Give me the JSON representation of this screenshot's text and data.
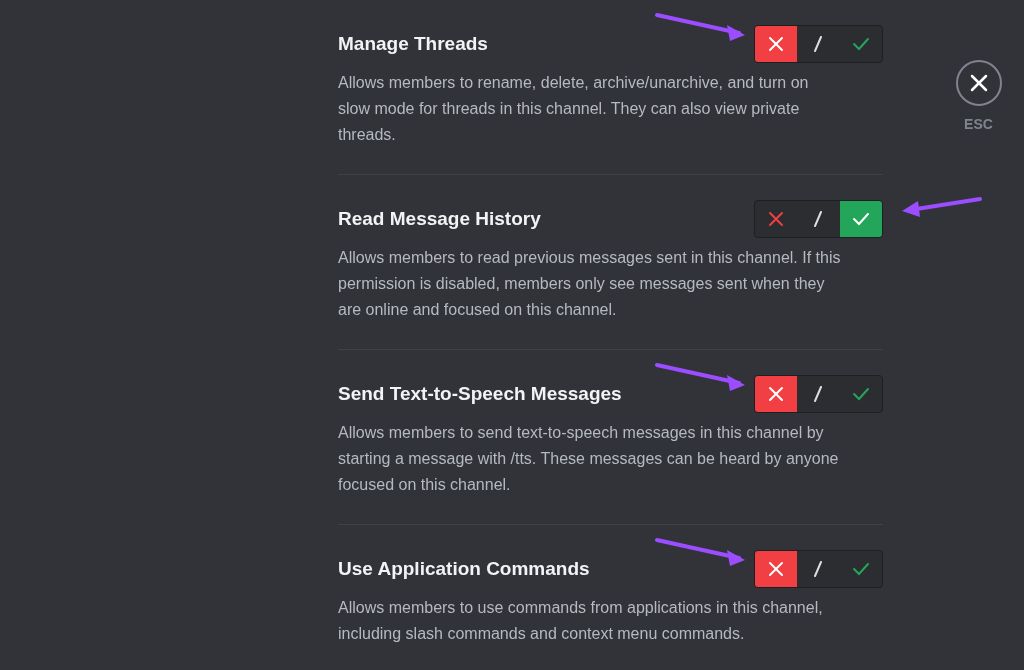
{
  "permissions": [
    {
      "title": "Manage Threads",
      "description": "Allows members to rename, delete, archive/unarchive, and turn on slow mode for threads in this channel. They can also view private threads.",
      "options": [
        {
          "kind": "deny",
          "selected": true
        },
        {
          "kind": "neutral",
          "selected": false
        },
        {
          "kind": "allow",
          "selected": false
        }
      ],
      "arrow": {
        "kind": "left"
      }
    },
    {
      "title": "Read Message History",
      "description": "Allows members to read previous messages sent in this channel. If this permission is disabled, members only see messages sent when they are online and focused on this channel.",
      "options": [
        {
          "kind": "deny",
          "selected": false
        },
        {
          "kind": "neutral",
          "selected": false
        },
        {
          "kind": "allow",
          "selected": true
        }
      ],
      "arrow": {
        "kind": "right"
      }
    },
    {
      "title": "Send Text-to-Speech Messages",
      "description": "Allows members to send text-to-speech messages in this channel by starting a message with /tts. These messages can be heard by anyone focused on this channel.",
      "options": [
        {
          "kind": "deny",
          "selected": true
        },
        {
          "kind": "neutral",
          "selected": false
        },
        {
          "kind": "allow",
          "selected": false
        }
      ],
      "arrow": {
        "kind": "left"
      }
    },
    {
      "title": "Use Application Commands",
      "description": "Allows members to use commands from applications in this channel, including slash commands and context menu commands.",
      "options": [
        {
          "kind": "deny",
          "selected": true
        },
        {
          "kind": "neutral",
          "selected": false
        },
        {
          "kind": "allow",
          "selected": false
        }
      ],
      "arrow": {
        "kind": "left"
      }
    }
  ],
  "close": {
    "label": "ESC"
  }
}
